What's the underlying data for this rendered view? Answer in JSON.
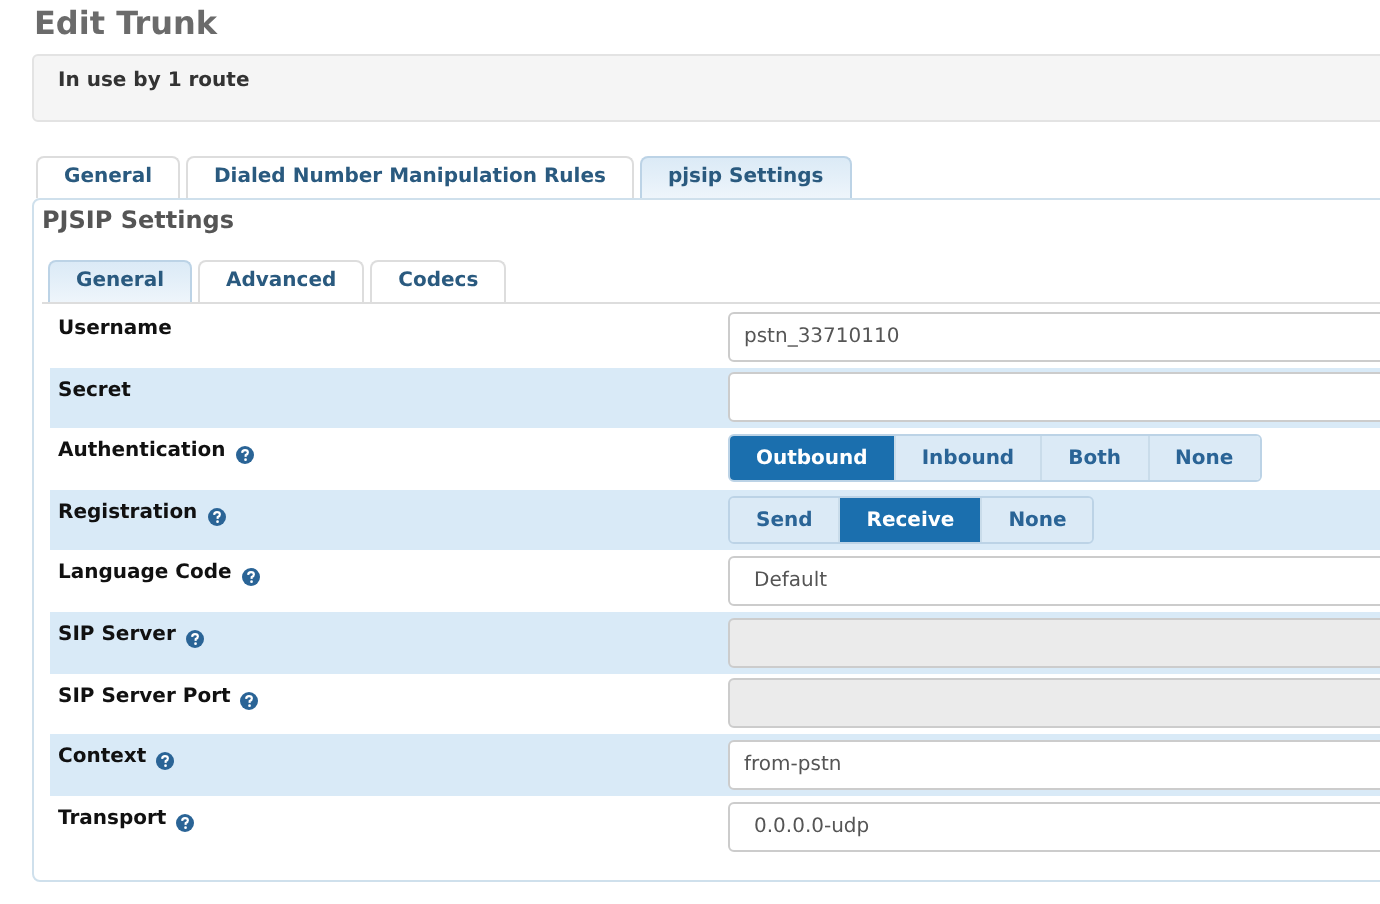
{
  "page_title": "Edit Trunk",
  "info": "In use by 1 route",
  "tabs": [
    {
      "label": "General",
      "selected": false
    },
    {
      "label": "Dialed Number Manipulation Rules",
      "selected": false
    },
    {
      "label": "pjsip Settings",
      "selected": true
    }
  ],
  "section_title": "PJSIP Settings",
  "subtabs": [
    {
      "label": "General",
      "selected": true
    },
    {
      "label": "Advanced",
      "selected": false
    },
    {
      "label": "Codecs",
      "selected": false
    }
  ],
  "rows": [
    {
      "label": "Username",
      "help": false,
      "kind": "text",
      "value": "pstn_33710110",
      "disabled": false
    },
    {
      "label": "Secret",
      "help": false,
      "kind": "text",
      "disabled": false
    },
    {
      "label": "Authentication",
      "help": true,
      "kind": "toggle",
      "options": [
        {
          "label": "Outbound",
          "selected": true
        },
        {
          "label": "Inbound",
          "selected": false
        },
        {
          "label": "Both",
          "selected": false
        },
        {
          "label": "None",
          "selected": false
        }
      ]
    },
    {
      "label": "Registration",
      "help": true,
      "kind": "toggle",
      "options": [
        {
          "label": "Send",
          "selected": false
        },
        {
          "label": "Receive",
          "selected": true
        },
        {
          "label": "None",
          "selected": false
        }
      ]
    },
    {
      "label": "Language Code",
      "help": true,
      "kind": "select",
      "value": "Default"
    },
    {
      "label": "SIP Server",
      "help": true,
      "kind": "text",
      "disabled": true
    },
    {
      "label": "SIP Server Port",
      "help": true,
      "kind": "text",
      "disabled": true
    },
    {
      "label": "Context",
      "help": true,
      "kind": "text",
      "value": "from-pstn",
      "disabled": false
    },
    {
      "label": "Transport",
      "help": true,
      "kind": "select",
      "value": "0.0.0.0-udp"
    }
  ]
}
